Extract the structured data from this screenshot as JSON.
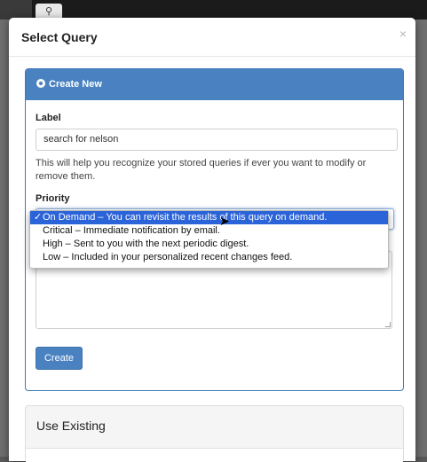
{
  "background": {
    "search_icon": "magnifier-icon"
  },
  "modal": {
    "title": "Select Query",
    "close_glyph": "×"
  },
  "create_panel": {
    "heading": "Create New",
    "label_field_label": "Label",
    "label_value": "search for nelson",
    "help_text": "This will help you recognize your stored queries if ever you want to modify or remove them.",
    "priority_label": "Priority",
    "create_button": "Create"
  },
  "priority_dropdown": {
    "options": [
      {
        "text": "On Demand – You can revisit the results of this query on demand.",
        "selected": true
      },
      {
        "text": "Critical – Immediate notification by email.",
        "selected": false
      },
      {
        "text": "High – Sent to you with the next periodic digest.",
        "selected": false
      },
      {
        "text": "Low – Included in your personalized recent changes feed.",
        "selected": false
      }
    ],
    "check_glyph": "✓"
  },
  "existing_panel": {
    "heading": "Use Existing"
  },
  "colors": {
    "primary": "#4a82c1",
    "selection": "#2b63d8"
  }
}
